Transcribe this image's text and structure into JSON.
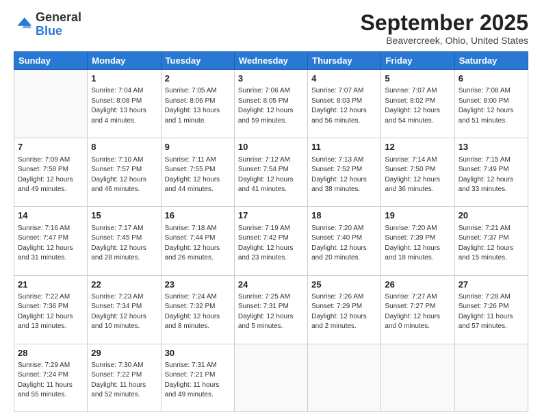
{
  "header": {
    "logo_general": "General",
    "logo_blue": "Blue",
    "month_title": "September 2025",
    "location": "Beavercreek, Ohio, United States"
  },
  "days_of_week": [
    "Sunday",
    "Monday",
    "Tuesday",
    "Wednesday",
    "Thursday",
    "Friday",
    "Saturday"
  ],
  "weeks": [
    [
      {
        "day": "",
        "info": ""
      },
      {
        "day": "1",
        "info": "Sunrise: 7:04 AM\nSunset: 8:08 PM\nDaylight: 13 hours\nand 4 minutes."
      },
      {
        "day": "2",
        "info": "Sunrise: 7:05 AM\nSunset: 8:06 PM\nDaylight: 13 hours\nand 1 minute."
      },
      {
        "day": "3",
        "info": "Sunrise: 7:06 AM\nSunset: 8:05 PM\nDaylight: 12 hours\nand 59 minutes."
      },
      {
        "day": "4",
        "info": "Sunrise: 7:07 AM\nSunset: 8:03 PM\nDaylight: 12 hours\nand 56 minutes."
      },
      {
        "day": "5",
        "info": "Sunrise: 7:07 AM\nSunset: 8:02 PM\nDaylight: 12 hours\nand 54 minutes."
      },
      {
        "day": "6",
        "info": "Sunrise: 7:08 AM\nSunset: 8:00 PM\nDaylight: 12 hours\nand 51 minutes."
      }
    ],
    [
      {
        "day": "7",
        "info": "Sunrise: 7:09 AM\nSunset: 7:58 PM\nDaylight: 12 hours\nand 49 minutes."
      },
      {
        "day": "8",
        "info": "Sunrise: 7:10 AM\nSunset: 7:57 PM\nDaylight: 12 hours\nand 46 minutes."
      },
      {
        "day": "9",
        "info": "Sunrise: 7:11 AM\nSunset: 7:55 PM\nDaylight: 12 hours\nand 44 minutes."
      },
      {
        "day": "10",
        "info": "Sunrise: 7:12 AM\nSunset: 7:54 PM\nDaylight: 12 hours\nand 41 minutes."
      },
      {
        "day": "11",
        "info": "Sunrise: 7:13 AM\nSunset: 7:52 PM\nDaylight: 12 hours\nand 38 minutes."
      },
      {
        "day": "12",
        "info": "Sunrise: 7:14 AM\nSunset: 7:50 PM\nDaylight: 12 hours\nand 36 minutes."
      },
      {
        "day": "13",
        "info": "Sunrise: 7:15 AM\nSunset: 7:49 PM\nDaylight: 12 hours\nand 33 minutes."
      }
    ],
    [
      {
        "day": "14",
        "info": "Sunrise: 7:16 AM\nSunset: 7:47 PM\nDaylight: 12 hours\nand 31 minutes."
      },
      {
        "day": "15",
        "info": "Sunrise: 7:17 AM\nSunset: 7:45 PM\nDaylight: 12 hours\nand 28 minutes."
      },
      {
        "day": "16",
        "info": "Sunrise: 7:18 AM\nSunset: 7:44 PM\nDaylight: 12 hours\nand 26 minutes."
      },
      {
        "day": "17",
        "info": "Sunrise: 7:19 AM\nSunset: 7:42 PM\nDaylight: 12 hours\nand 23 minutes."
      },
      {
        "day": "18",
        "info": "Sunrise: 7:20 AM\nSunset: 7:40 PM\nDaylight: 12 hours\nand 20 minutes."
      },
      {
        "day": "19",
        "info": "Sunrise: 7:20 AM\nSunset: 7:39 PM\nDaylight: 12 hours\nand 18 minutes."
      },
      {
        "day": "20",
        "info": "Sunrise: 7:21 AM\nSunset: 7:37 PM\nDaylight: 12 hours\nand 15 minutes."
      }
    ],
    [
      {
        "day": "21",
        "info": "Sunrise: 7:22 AM\nSunset: 7:36 PM\nDaylight: 12 hours\nand 13 minutes."
      },
      {
        "day": "22",
        "info": "Sunrise: 7:23 AM\nSunset: 7:34 PM\nDaylight: 12 hours\nand 10 minutes."
      },
      {
        "day": "23",
        "info": "Sunrise: 7:24 AM\nSunset: 7:32 PM\nDaylight: 12 hours\nand 8 minutes."
      },
      {
        "day": "24",
        "info": "Sunrise: 7:25 AM\nSunset: 7:31 PM\nDaylight: 12 hours\nand 5 minutes."
      },
      {
        "day": "25",
        "info": "Sunrise: 7:26 AM\nSunset: 7:29 PM\nDaylight: 12 hours\nand 2 minutes."
      },
      {
        "day": "26",
        "info": "Sunrise: 7:27 AM\nSunset: 7:27 PM\nDaylight: 12 hours\nand 0 minutes."
      },
      {
        "day": "27",
        "info": "Sunrise: 7:28 AM\nSunset: 7:26 PM\nDaylight: 11 hours\nand 57 minutes."
      }
    ],
    [
      {
        "day": "28",
        "info": "Sunrise: 7:29 AM\nSunset: 7:24 PM\nDaylight: 11 hours\nand 55 minutes."
      },
      {
        "day": "29",
        "info": "Sunrise: 7:30 AM\nSunset: 7:22 PM\nDaylight: 11 hours\nand 52 minutes."
      },
      {
        "day": "30",
        "info": "Sunrise: 7:31 AM\nSunset: 7:21 PM\nDaylight: 11 hours\nand 49 minutes."
      },
      {
        "day": "",
        "info": ""
      },
      {
        "day": "",
        "info": ""
      },
      {
        "day": "",
        "info": ""
      },
      {
        "day": "",
        "info": ""
      }
    ]
  ]
}
